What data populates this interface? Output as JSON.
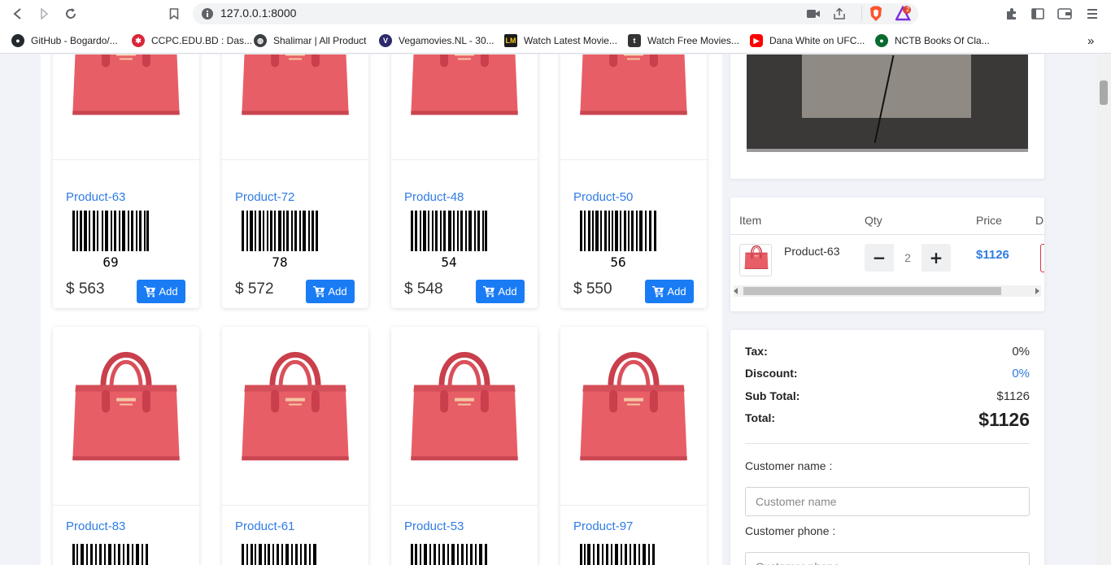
{
  "browser": {
    "url": "127.0.0.1:8000",
    "bookmarks": [
      {
        "label": "GitHub - Bogardo/...",
        "icon": "github-icon"
      },
      {
        "label": "CCPC.EDU.BD : Das...",
        "icon": "ccpc-icon"
      },
      {
        "label": "Shalimar | All Product",
        "icon": "globe-icon"
      },
      {
        "label": "Vegamovies.NL - 30...",
        "icon": "vegamovies-icon"
      },
      {
        "label": "Watch Latest Movie...",
        "icon": "movie-icon"
      },
      {
        "label": "Watch Free Movies...",
        "icon": "tubi-icon"
      },
      {
        "label": "Dana White on UFC...",
        "icon": "youtube-icon"
      },
      {
        "label": "NCTB Books Of Cla...",
        "icon": "nctb-icon"
      }
    ],
    "more_bookmarks": "»",
    "brave_badge": "2"
  },
  "products_row1": [
    {
      "name": "Product-63",
      "code": "69",
      "price": "$ 563"
    },
    {
      "name": "Product-72",
      "code": "78",
      "price": "$ 572"
    },
    {
      "name": "Product-48",
      "code": "54",
      "price": "$ 548"
    },
    {
      "name": "Product-50",
      "code": "56",
      "price": "$ 550"
    }
  ],
  "products_row2": [
    {
      "name": "Product-83"
    },
    {
      "name": "Product-61"
    },
    {
      "name": "Product-53"
    },
    {
      "name": "Product-97"
    }
  ],
  "add_label": "Add",
  "cart": {
    "headers": {
      "item": "Item",
      "qty": "Qty",
      "price": "Price",
      "delete": "D"
    },
    "items": [
      {
        "name": "Product-63",
        "qty": "2",
        "price": "$1126"
      }
    ],
    "minus": "−",
    "plus": "+"
  },
  "summary": {
    "tax_label": "Tax:",
    "tax": "0%",
    "discount_label": "Discount:",
    "discount": "0%",
    "subtotal_label": "Sub Total:",
    "subtotal": "$1126",
    "total_label": "Total:",
    "total": "$1126"
  },
  "form": {
    "name_label": "Customer name :",
    "name_placeholder": "Customer name",
    "phone_label": "Customer phone :",
    "phone_placeholder": "Customer phone"
  },
  "colors": {
    "accent": "#1a7cf5",
    "link": "#2f7be5",
    "bag": "#e85e67"
  }
}
